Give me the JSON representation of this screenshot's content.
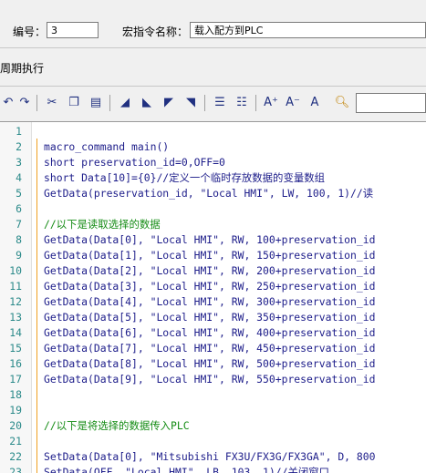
{
  "header": {
    "number_label": "编号：",
    "number_value": "3",
    "macro_name_label": "宏指令名称：",
    "macro_name_value": "载入配方到PLC",
    "periodic_label": "周期执行"
  },
  "toolbar": {
    "icons": [
      "undo-icon",
      "redo-icon",
      "cut-icon",
      "copy-icon",
      "paste-icon",
      "bookmark-toggle-icon",
      "bookmark-next-icon",
      "bookmark-prev-icon",
      "bookmark-clear-icon",
      "indent-icon",
      "outdent-icon",
      "font-increase-icon",
      "font-decrease-icon",
      "font-reset-icon",
      "find-icon"
    ],
    "font_increase": "A⁺",
    "font_decrease": "A⁻",
    "font_reset": "A",
    "search_value": ""
  },
  "editor": {
    "lines": [
      {
        "n": "1",
        "text": "",
        "kind": "code"
      },
      {
        "n": "2",
        "text": "macro_command main()",
        "kind": "code"
      },
      {
        "n": "3",
        "text": "short preservation_id=0,OFF=0",
        "kind": "code"
      },
      {
        "n": "4",
        "text": "short Data[10]={0}//定义一个临时存放数据的变量数组",
        "kind": "code"
      },
      {
        "n": "5",
        "text": "GetData(preservation_id, \"Local HMI\", LW, 100, 1)//读",
        "kind": "code"
      },
      {
        "n": "6",
        "text": "",
        "kind": "code"
      },
      {
        "n": "7",
        "text": "//以下是读取选择的数据",
        "kind": "comment"
      },
      {
        "n": "8",
        "text": "GetData(Data[0], \"Local HMI\", RW, 100+preservation_id",
        "kind": "code"
      },
      {
        "n": "9",
        "text": "GetData(Data[1], \"Local HMI\", RW, 150+preservation_id",
        "kind": "code"
      },
      {
        "n": "10",
        "text": "GetData(Data[2], \"Local HMI\", RW, 200+preservation_id",
        "kind": "code"
      },
      {
        "n": "11",
        "text": "GetData(Data[3], \"Local HMI\", RW, 250+preservation_id",
        "kind": "code"
      },
      {
        "n": "12",
        "text": "GetData(Data[4], \"Local HMI\", RW, 300+preservation_id",
        "kind": "code"
      },
      {
        "n": "13",
        "text": "GetData(Data[5], \"Local HMI\", RW, 350+preservation_id",
        "kind": "code"
      },
      {
        "n": "14",
        "text": "GetData(Data[6], \"Local HMI\", RW, 400+preservation_id",
        "kind": "code"
      },
      {
        "n": "15",
        "text": "GetData(Data[7], \"Local HMI\", RW, 450+preservation_id",
        "kind": "code"
      },
      {
        "n": "16",
        "text": "GetData(Data[8], \"Local HMI\", RW, 500+preservation_id",
        "kind": "code"
      },
      {
        "n": "17",
        "text": "GetData(Data[9], \"Local HMI\", RW, 550+preservation_id",
        "kind": "code"
      },
      {
        "n": "18",
        "text": "",
        "kind": "code"
      },
      {
        "n": "19",
        "text": "",
        "kind": "code"
      },
      {
        "n": "20",
        "text": "//以下是将选择的数据传入PLC",
        "kind": "comment"
      },
      {
        "n": "21",
        "text": "",
        "kind": "code"
      },
      {
        "n": "22",
        "text": "SetData(Data[0], \"Mitsubishi FX3U/FX3G/FX3GA\", D, 800",
        "kind": "code"
      },
      {
        "n": "23",
        "text": "SetData(OFF, \"Local HMI\", LB, 103, 1)//关闭窗口",
        "kind": "code"
      }
    ]
  }
}
